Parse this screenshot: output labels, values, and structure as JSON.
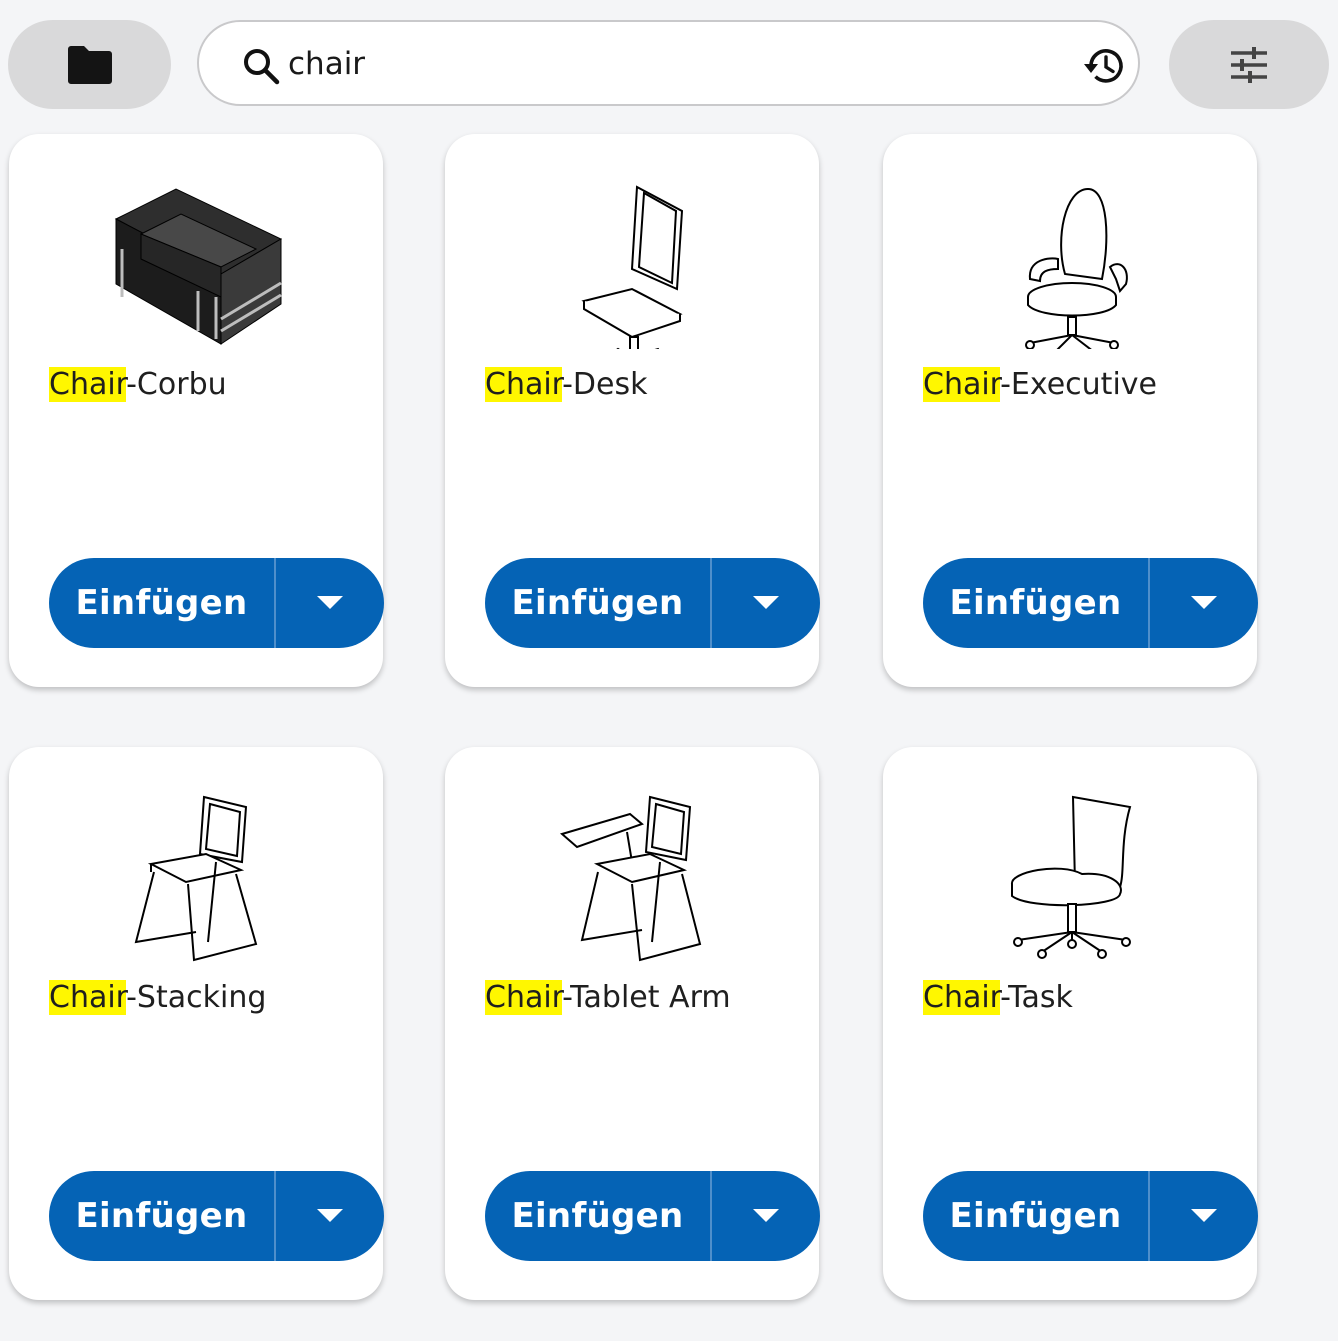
{
  "toolbar": {
    "folder_icon": "folder-icon",
    "filter_icon": "tune-sliders-icon"
  },
  "search": {
    "value": "chair",
    "search_icon": "search-icon",
    "history_icon": "history-icon"
  },
  "colors": {
    "accent": "#0563b5",
    "highlight": "#fff700",
    "pill_gray": "#d9d9da",
    "background": "#f4f5f7"
  },
  "cards": [
    {
      "highlight": "Chair",
      "rest": "-Corbu",
      "button": "Einfügen",
      "thumbnail": "lounge-armchair-image"
    },
    {
      "highlight": "Chair",
      "rest": "-Desk",
      "button": "Einfügen",
      "thumbnail": "desk-chair-image"
    },
    {
      "highlight": "Chair",
      "rest": "-Executive",
      "button": "Einfügen",
      "thumbnail": "executive-chair-image"
    },
    {
      "highlight": "Chair",
      "rest": "-Stacking",
      "button": "Einfügen",
      "thumbnail": "stacking-chair-image"
    },
    {
      "highlight": "Chair",
      "rest": "-Tablet Arm",
      "button": "Einfügen",
      "thumbnail": "tablet-arm-chair-image"
    },
    {
      "highlight": "Chair",
      "rest": "-Task",
      "button": "Einfügen",
      "thumbnail": "task-chair-image"
    }
  ]
}
